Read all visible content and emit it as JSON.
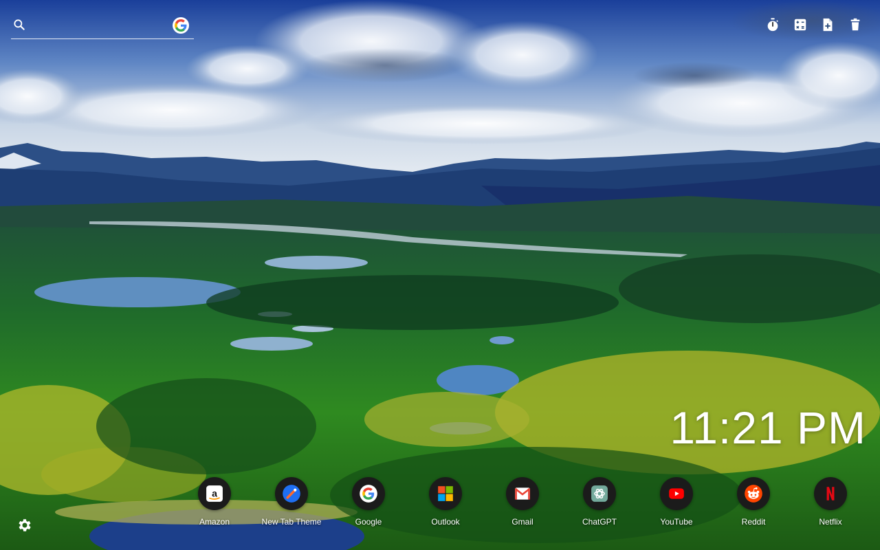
{
  "search": {
    "placeholder": "",
    "value": "",
    "icon": "search-icon",
    "engine_icon": "google-icon"
  },
  "toolbar": {
    "items": [
      {
        "icon": "stopwatch-icon"
      },
      {
        "icon": "calculator-icon"
      },
      {
        "icon": "add-note-icon"
      },
      {
        "icon": "trash-icon"
      }
    ]
  },
  "clock": {
    "time": "11:21 PM"
  },
  "shortcuts": [
    {
      "label": "Amazon",
      "icon": "amazon-icon"
    },
    {
      "label": "New Tab Theme",
      "icon": "new-tab-theme-icon"
    },
    {
      "label": "Google",
      "icon": "google-icon"
    },
    {
      "label": "Outlook",
      "icon": "outlook-icon"
    },
    {
      "label": "Gmail",
      "icon": "gmail-icon"
    },
    {
      "label": "ChatGPT",
      "icon": "chatgpt-icon"
    },
    {
      "label": "YouTube",
      "icon": "youtube-icon"
    },
    {
      "label": "Reddit",
      "icon": "reddit-icon"
    },
    {
      "label": "Netflix",
      "icon": "netflix-icon"
    }
  ],
  "settings": {
    "icon": "gear-icon"
  },
  "colors": {
    "google_blue": "#4285F4",
    "google_red": "#EA4335",
    "google_yellow": "#FBBC05",
    "google_green": "#34A853",
    "youtube_red": "#FF0000",
    "reddit_orange": "#FF4500",
    "netflix_red": "#E50914"
  }
}
